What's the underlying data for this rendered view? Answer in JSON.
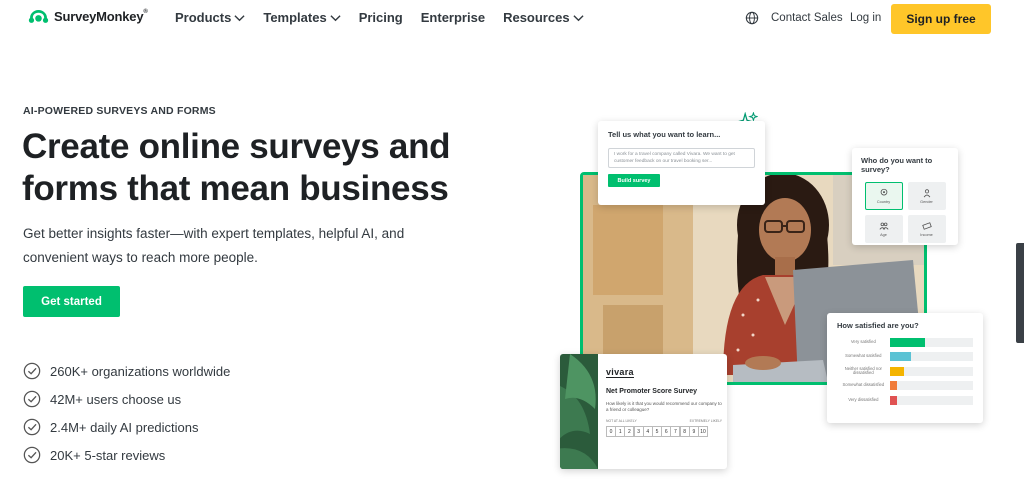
{
  "nav": {
    "logo_text": "SurveyMonkey",
    "logo_reg": "®",
    "links": [
      "Products",
      "Templates",
      "Pricing",
      "Enterprise",
      "Resources"
    ],
    "contact": "Contact Sales",
    "login": "Log in",
    "signup": "Sign up free"
  },
  "hero": {
    "eyebrow": "AI-POWERED SURVEYS AND FORMS",
    "headline": "Create online surveys and forms that mean business",
    "subtitle": "Get better insights faster—with expert templates, helpful AI, and convenient ways to reach more people.",
    "cta": "Get started",
    "stats": [
      "260K+ organizations worldwide",
      "42M+ users choose us",
      "2.4M+ daily AI predictions",
      "20K+ 5-star reviews"
    ]
  },
  "cards": {
    "learn": {
      "title": "Tell us what you want to learn...",
      "placeholder": "I work for a travel company called Vivara. We want to get customer feedback on our travel booking ser...",
      "button": "Build survey"
    },
    "who": {
      "title": "Who do you want to survey?",
      "options": [
        "Country",
        "Gender",
        "Age",
        "Income"
      ]
    },
    "satisfied": {
      "title": "How satisfied are you?",
      "rows": [
        {
          "label": "Very satisfied",
          "value": 0.42,
          "color": "#00bf6f"
        },
        {
          "label": "Somewhat satisfied",
          "value": 0.25,
          "color": "#5bc2d4"
        },
        {
          "label": "Neither satisfied nor dissatisfied",
          "value": 0.17,
          "color": "#f4b400"
        },
        {
          "label": "Somewhat dissatisfied",
          "value": 0.09,
          "color": "#f07c3a"
        },
        {
          "label": "Very dissatisfied",
          "value": 0.09,
          "color": "#e05252"
        }
      ]
    },
    "nps": {
      "brand": "vivara",
      "title": "Net Promoter Score Survey",
      "question": "How likely is it that you would recommend our company to a friend or colleague?",
      "low_label": "NOT AT ALL LIKELY",
      "high_label": "EXTREMELY LIKELY",
      "scale": [
        "0",
        "1",
        "2",
        "3",
        "4",
        "5",
        "6",
        "7",
        "8",
        "9",
        "10"
      ]
    }
  },
  "colors": {
    "brand_green": "#00bf6f",
    "cta_yellow": "#ffc629",
    "text": "#1e2124"
  }
}
